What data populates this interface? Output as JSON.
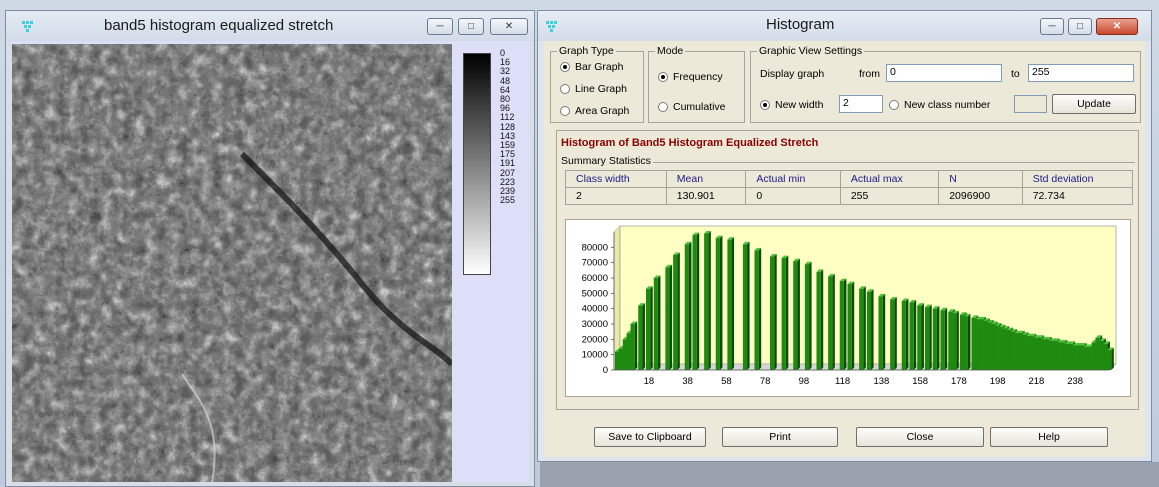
{
  "left_window": {
    "title": "band5 histogram equalized stretch",
    "scale_labels": [
      "0",
      "16",
      "32",
      "48",
      "64",
      "80",
      "96",
      "112",
      "128",
      "143",
      "159",
      "175",
      "191",
      "207",
      "223",
      "239",
      "255"
    ]
  },
  "right_window": {
    "title": "Histogram",
    "graph_type": {
      "legend": "Graph Type",
      "options": [
        "Bar Graph",
        "Line Graph",
        "Area Graph"
      ],
      "selected": "Bar Graph"
    },
    "mode": {
      "legend": "Mode",
      "options": [
        "Frequency",
        "Cumulative"
      ],
      "selected": "Frequency"
    },
    "view_settings": {
      "legend": "Graphic View Settings",
      "display_graph_label": "Display graph",
      "from_label": "from",
      "from_value": "0",
      "to_label": "to",
      "to_value": "255",
      "new_width_label": "New width",
      "new_width_value": "2",
      "new_class_label": "New class number",
      "new_class_value": "",
      "update_label": "Update"
    },
    "histogram_title": "Histogram of Band5 Histogram Equalized Stretch",
    "summary_label": "Summary Statistics",
    "stats": {
      "headers": [
        "Class width",
        "Mean",
        "Actual min",
        "Actual max",
        "N",
        "Std deviation"
      ],
      "values": [
        "2",
        "130.901",
        "0",
        "255",
        "2096900",
        "72.734"
      ]
    },
    "buttons": {
      "save": "Save to Clipboard",
      "print": "Print",
      "close": "Close",
      "help": "Help"
    }
  },
  "colors": {
    "bar": "#1f8a10",
    "chart_bg": "#ffffc4",
    "title_red": "#8b0000"
  },
  "chart_data": {
    "type": "bar",
    "title": "",
    "xlabel": "",
    "ylabel": "",
    "x_ticks": [
      "18",
      "38",
      "58",
      "78",
      "98",
      "118",
      "138",
      "158",
      "178",
      "198",
      "218",
      "238"
    ],
    "y_ticks": [
      "0",
      "10000",
      "20000",
      "30000",
      "40000",
      "50000",
      "60000",
      "70000",
      "80000"
    ],
    "xlim": [
      0,
      256
    ],
    "ylim": [
      0,
      90000
    ],
    "x": [
      0,
      2,
      4,
      6,
      8,
      12,
      16,
      20,
      26,
      30,
      36,
      40,
      46,
      52,
      58,
      66,
      72,
      80,
      86,
      92,
      98,
      104,
      110,
      116,
      120,
      126,
      130,
      136,
      142,
      148,
      152,
      156,
      160,
      164,
      168,
      172,
      174,
      178,
      180,
      184,
      186,
      188,
      190,
      192,
      194,
      196,
      198,
      200,
      202,
      204,
      206,
      208,
      210,
      212,
      214,
      216,
      218,
      220,
      222,
      224,
      226,
      228,
      230,
      232,
      234,
      236,
      238,
      240,
      242,
      244,
      246,
      248,
      250,
      252,
      254
    ],
    "values": [
      12000,
      14000,
      20000,
      24000,
      30000,
      42000,
      53000,
      60000,
      67000,
      75000,
      82000,
      88000,
      89000,
      86000,
      85000,
      82000,
      78000,
      74000,
      73000,
      71000,
      69000,
      64000,
      61000,
      58000,
      56000,
      53000,
      51000,
      48000,
      46000,
      45000,
      44000,
      42000,
      41000,
      40000,
      39000,
      38000,
      37000,
      36000,
      35000,
      34000,
      33000,
      33000,
      32000,
      31000,
      30000,
      29000,
      28000,
      27000,
      26000,
      25000,
      24000,
      24000,
      23000,
      22000,
      22000,
      21000,
      21000,
      20000,
      20000,
      19000,
      19000,
      18000,
      18000,
      17000,
      17000,
      16000,
      16000,
      16000,
      15000,
      15000,
      18000,
      21000,
      19000,
      17000,
      13000
    ]
  }
}
